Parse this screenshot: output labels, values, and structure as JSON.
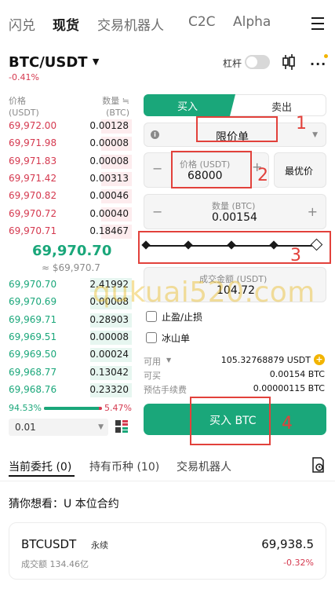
{
  "nav": {
    "tabs": [
      "闪兑",
      "现货",
      "交易机器人",
      "C2C",
      "Alpha"
    ],
    "menu_icon": "hamburger-menu-icon"
  },
  "pair": {
    "name": "BTC/USDT",
    "change": "-0.41%",
    "leverage_label": "杠杆"
  },
  "orderbook": {
    "price_header": "价格",
    "price_unit": "(USDT)",
    "qty_header": "数量 ≒",
    "qty_unit": "(BTC)",
    "asks": [
      {
        "price": "69,972.00",
        "qty": "0.00128",
        "depth": 0.22
      },
      {
        "price": "69,971.98",
        "qty": "0.00008",
        "depth": 0.22
      },
      {
        "price": "69,971.83",
        "qty": "0.00008",
        "depth": 0.22
      },
      {
        "price": "69,971.42",
        "qty": "0.00313",
        "depth": 0.22
      },
      {
        "price": "69,970.82",
        "qty": "0.00046",
        "depth": 0.22
      },
      {
        "price": "69,970.72",
        "qty": "0.00040",
        "depth": 0.22
      },
      {
        "price": "69,970.71",
        "qty": "0.18467",
        "depth": 0.22
      }
    ],
    "last_price": "69,970.70",
    "last_price_usd": "≈ $69,970.7",
    "bids": [
      {
        "price": "69,970.70",
        "qty": "2.41992",
        "depth": 0.3
      },
      {
        "price": "69,970.69",
        "qty": "0.00008",
        "depth": 0.3
      },
      {
        "price": "69,969.71",
        "qty": "0.28903",
        "depth": 0.3
      },
      {
        "price": "69,969.51",
        "qty": "0.00008",
        "depth": 0.3
      },
      {
        "price": "69,969.50",
        "qty": "0.00024",
        "depth": 0.3
      },
      {
        "price": "69,968.77",
        "qty": "0.13042",
        "depth": 0.3
      },
      {
        "price": "69,968.76",
        "qty": "0.23320",
        "depth": 0.3
      }
    ],
    "buy_ratio": "94.53%",
    "sell_ratio": "5.47%",
    "buy_ratio_value": 0.9453,
    "precision": "0.01"
  },
  "form": {
    "buy_tab": "买入",
    "sell_tab": "卖出",
    "order_type": "限价单",
    "price_label": "价格 (USDT)",
    "price_value": "68000",
    "best_price_button": "最优价",
    "qty_label": "数量 (BTC)",
    "qty_value": "0.00154",
    "slider_steps": 5,
    "total_label": "成交金额 (USDT)",
    "total_value": "104.72",
    "tp_sl_label": "止盈/止损",
    "iceberg_label": "冰山单",
    "available_label": "可用",
    "available_value": "105.32768879 USDT",
    "can_buy_label": "可买",
    "can_buy_value": "0.00154 BTC",
    "fee_label": "预估手续费",
    "fee_value": "0.00000115 BTC",
    "submit_button": "买入 BTC"
  },
  "annotations": [
    "1",
    "2",
    "3",
    "4"
  ],
  "bottom_tabs": {
    "open_orders": "当前委托 (0)",
    "holdings": "持有币种 (10)",
    "bots": "交易机器人"
  },
  "suggest": {
    "title": "猜你想看：U 本位合约",
    "symbol": "BTCUSDT",
    "type": "永续",
    "price": "69,938.5",
    "volume": "成交额 134.46亿",
    "change": "-0.32%"
  },
  "watermark": "qukuai520.com",
  "colors": {
    "green": "#1aa77a",
    "red": "#d5394f",
    "annotation": "#e2413b"
  }
}
